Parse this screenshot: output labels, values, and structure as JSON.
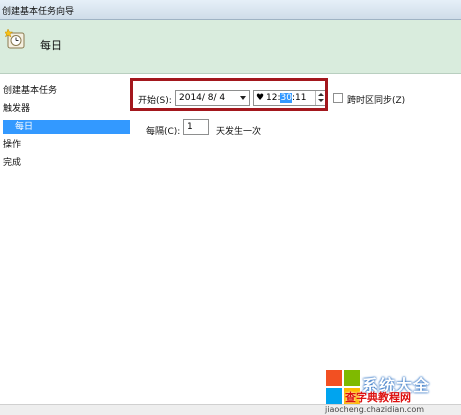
{
  "window": {
    "title": "创建基本任务向导"
  },
  "banner": {
    "heading": "每日",
    "icon": "clock-icon"
  },
  "sidebar": {
    "items": [
      {
        "label": "创建基本任务",
        "selected": false,
        "indent": false
      },
      {
        "label": "触发器",
        "selected": false,
        "indent": false
      },
      {
        "label": "每日",
        "selected": true,
        "indent": true
      },
      {
        "label": "操作",
        "selected": false,
        "indent": false
      },
      {
        "label": "完成",
        "selected": false,
        "indent": false
      }
    ]
  },
  "form": {
    "start_label": "开始(S):",
    "date_value": "2014/  8/  4",
    "time_prefix": "12:",
    "time_selected": "30",
    "time_suffix": ":11",
    "sync_timezone_label": "跨时区同步(Z)",
    "sync_timezone_checked": false,
    "recur_label": "每隔(C):",
    "recur_value": "1",
    "recur_unit": "天发生一次"
  },
  "watermark": {
    "brand": "系统大全",
    "sub": "查字典教程网",
    "url": "jiaocheng.chazidian.com"
  },
  "colors": {
    "banner_bg": "#d9ecdd",
    "highlight_border": "#a3171d",
    "selection_blue": "#3399ff"
  }
}
